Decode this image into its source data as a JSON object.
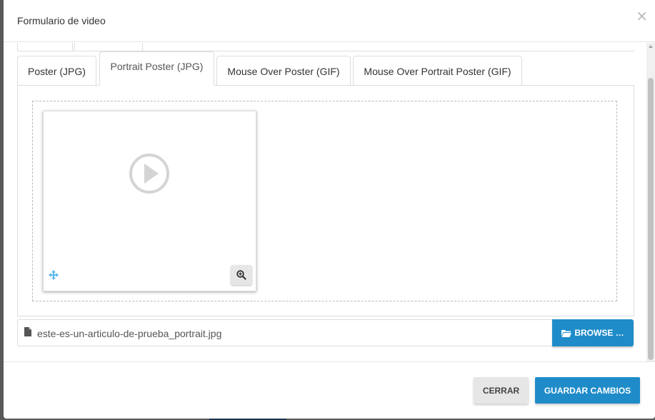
{
  "modal": {
    "title": "Formulario de video",
    "close_label": "×"
  },
  "tabs": [
    {
      "label": "Poster (JPG)",
      "active": false
    },
    {
      "label": "Portrait Poster (JPG)",
      "active": true
    },
    {
      "label": "Mouse Over Poster (GIF)",
      "active": false
    },
    {
      "label": "Mouse Over Portrait Poster (GIF)",
      "active": false
    }
  ],
  "preview": {
    "play_icon": "play-circle-icon",
    "move_icon": "move-arrows-icon",
    "zoom_icon": "zoom-in-icon"
  },
  "file": {
    "icon": "file-icon",
    "name": "este-es-un-articulo-de-prueba_portrait.jpg",
    "browse_label": "BROWSE …",
    "browse_icon": "folder-open-icon"
  },
  "footer": {
    "close_label": "CERRAR",
    "save_label": "GUARDAR CAMBIOS"
  },
  "colors": {
    "primary": "#1f8cc9",
    "secondary_button": "#e6e6e6",
    "move_icon": "#5bb8ea"
  }
}
